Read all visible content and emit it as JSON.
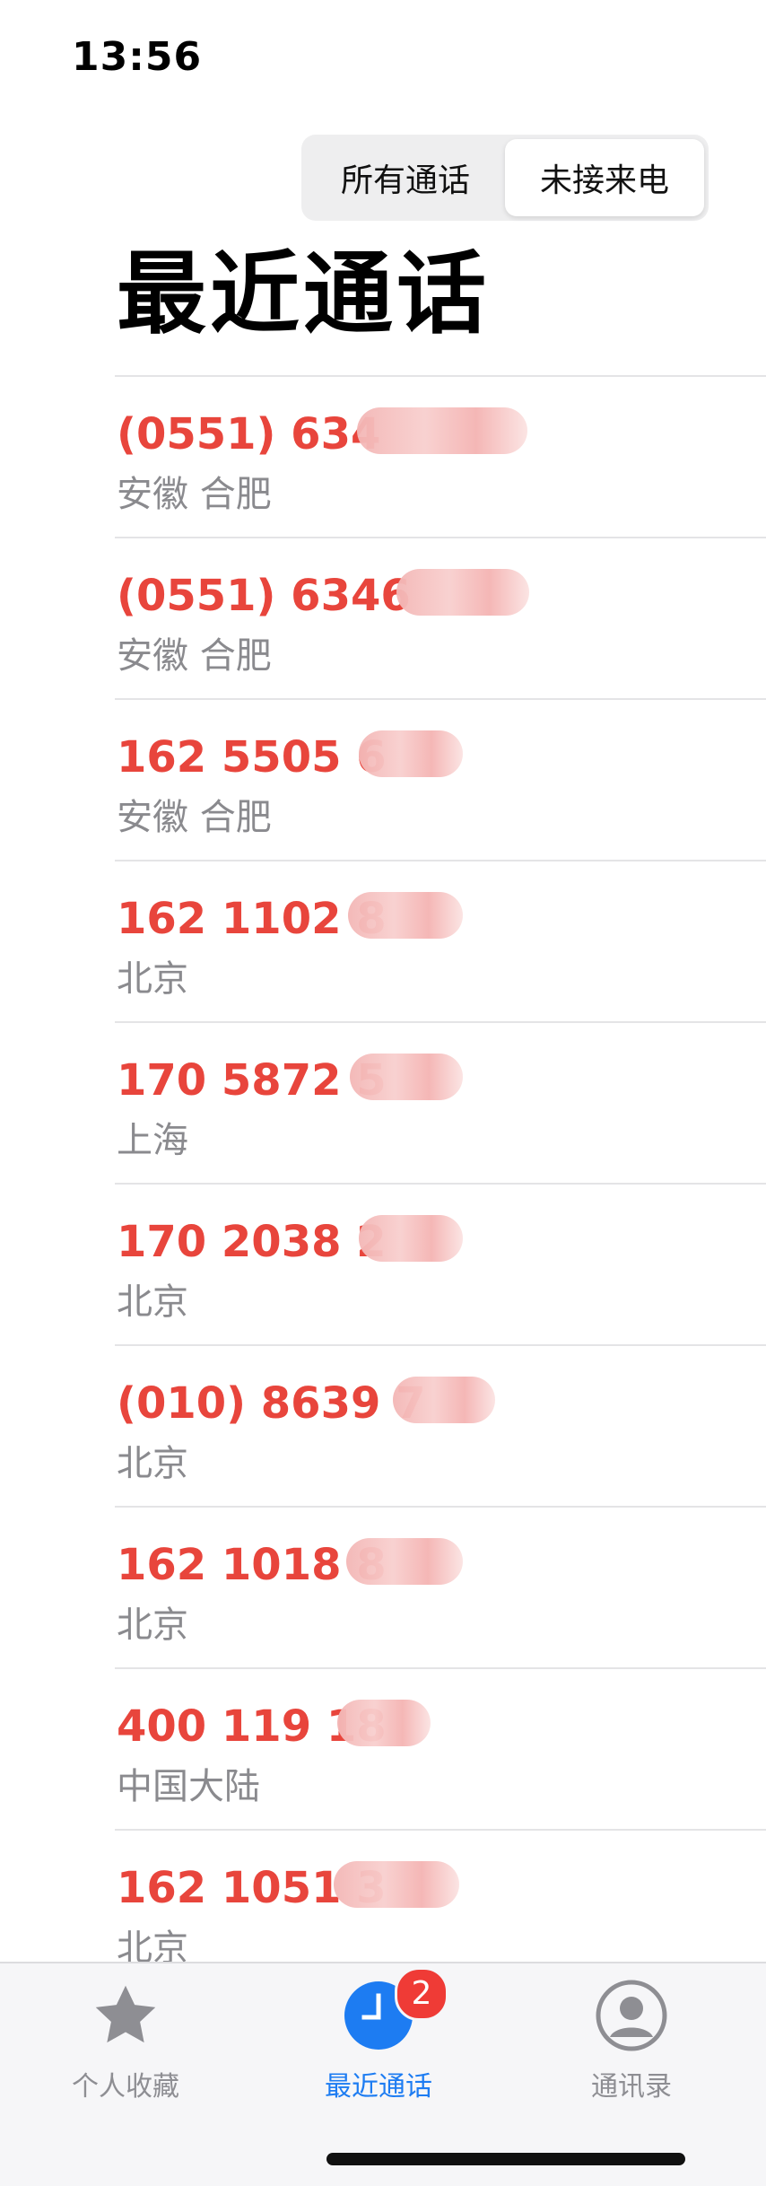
{
  "status_bar": {
    "time": "13:56"
  },
  "segmented_control": {
    "options": [
      {
        "label": "所有通话",
        "active": false
      },
      {
        "label": "未接来电",
        "active": true
      }
    ]
  },
  "page_title": "最近通话",
  "calls": [
    {
      "number": "(0551) 634",
      "location": "安徽 合肥"
    },
    {
      "number": "(0551) 6346",
      "location": "安徽 合肥"
    },
    {
      "number": "162 5505 6",
      "location": "安徽 合肥"
    },
    {
      "number": "162 1102 8",
      "location": "北京"
    },
    {
      "number": "170 5872 5",
      "location": "上海"
    },
    {
      "number": "170 2038 2",
      "location": "北京"
    },
    {
      "number": "(010) 8639 7",
      "location": "北京"
    },
    {
      "number": "162 1018 8",
      "location": "北京"
    },
    {
      "number": "400 119 18",
      "location": "中国大陆"
    },
    {
      "number": "162 1051 3",
      "location": "北京"
    }
  ],
  "tab_bar": {
    "tabs": [
      {
        "label": "个人收藏",
        "icon": "star-icon",
        "active": false
      },
      {
        "label": "最近通话",
        "icon": "clock-icon",
        "active": true,
        "badge": "2"
      },
      {
        "label": "通讯录",
        "icon": "person-icon",
        "active": false
      }
    ]
  },
  "colors": {
    "missed_red": "#e8453c",
    "accent_blue": "#1d7cf2",
    "secondary_gray": "#8a8a8e",
    "badge_red": "#ef3b36"
  }
}
